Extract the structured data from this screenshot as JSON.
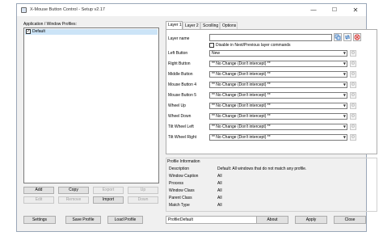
{
  "window": {
    "title": "X-Mouse Button Control - Setup v2.17",
    "controls": {
      "minimize": "—",
      "maximize": "☐",
      "close": "✕"
    }
  },
  "profiles": {
    "label": "Application / Window Profiles:",
    "items": [
      {
        "label": "Default",
        "checked": true
      }
    ]
  },
  "profile_buttons": {
    "add": "Add",
    "copy": "Copy",
    "export": "Export",
    "up": "Up",
    "edit": "Edit",
    "remove": "Remove",
    "import": "Import",
    "down": "Down"
  },
  "tabs": [
    {
      "label": "Layer 1",
      "active": true
    },
    {
      "label": "Layer 2",
      "active": false
    },
    {
      "label": "Scrolling",
      "active": false
    },
    {
      "label": "Options",
      "active": false
    }
  ],
  "layer": {
    "name_label": "Layer name",
    "name_value": "",
    "disable_label": "Disable in Next/Previous layer commands",
    "rows": [
      {
        "label": "Left Button",
        "value": "New"
      },
      {
        "label": "Right Button",
        "value": "** No Change (Don't intercept) **"
      },
      {
        "label": "Middle Button",
        "value": "** No Change (Don't intercept) **"
      },
      {
        "label": "Mouse Button 4",
        "value": "** No Change (Don't intercept) **"
      },
      {
        "label": "Mouse Button 5",
        "value": "** No Change (Don't intercept) **"
      },
      {
        "label": "Wheel Up",
        "value": "** No Change (Don't intercept) **"
      },
      {
        "label": "Wheel Down",
        "value": "** No Change (Don't intercept) **"
      },
      {
        "label": "Tilt Wheel Left",
        "value": "** No Change (Don't intercept) **"
      },
      {
        "label": "Tilt Wheel Right",
        "value": "** No Change (Don't intercept) **"
      }
    ]
  },
  "profile_info": {
    "title": "Profile Information",
    "rows": [
      {
        "key": "Description",
        "value": "Default: All windows that do not match any profile."
      },
      {
        "key": "Window Caption",
        "value": "All"
      },
      {
        "key": "Process",
        "value": "All"
      },
      {
        "key": "Window Class",
        "value": "All"
      },
      {
        "key": "Parent Class",
        "value": "All"
      },
      {
        "key": "Match Type",
        "value": "All"
      }
    ]
  },
  "bottom": {
    "settings": "Settings",
    "save_profile": "Save Profile",
    "load_profile": "Load Profile",
    "profile_label": "Profile:",
    "profile_value": "Default",
    "about": "About",
    "apply": "Apply",
    "close": "Close"
  },
  "colors": {
    "selection": "#cce4f7",
    "accent_blue": "#2a6ebb",
    "close_red": "#d9302c"
  },
  "icons": {
    "dropdown": "chevron-down-icon",
    "settings": "gear-icon",
    "layer_copy": "copy-layers-icon",
    "layer_swap": "swap-layers-icon",
    "layer_clear": "clear-layer-icon"
  }
}
